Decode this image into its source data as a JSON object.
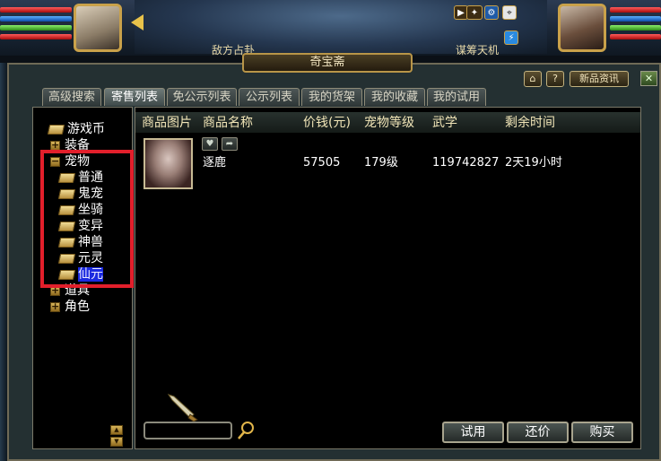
{
  "hud": {
    "left_label": "敌方占卦",
    "right_label": "谋筹天机",
    "window_title": "奇宝斋"
  },
  "toolbar": {
    "home_icon": "home-icon",
    "help_label": "?",
    "news_label": "新品资讯",
    "close_label": "✕"
  },
  "tabs": [
    {
      "label": "高级搜索"
    },
    {
      "label": "寄售列表"
    },
    {
      "label": "免公示列表"
    },
    {
      "label": "公示列表"
    },
    {
      "label": "我的货架"
    },
    {
      "label": "我的收藏"
    },
    {
      "label": "我的试用"
    }
  ],
  "tree": {
    "items": [
      {
        "label": "游戏币"
      },
      {
        "label": "装备"
      },
      {
        "label": "宠物"
      },
      {
        "label": "普通"
      },
      {
        "label": "鬼宠"
      },
      {
        "label": "坐骑"
      },
      {
        "label": "变异"
      },
      {
        "label": "神兽"
      },
      {
        "label": "元灵"
      },
      {
        "label": "仙元"
      },
      {
        "label": "道具"
      },
      {
        "label": "角色"
      }
    ]
  },
  "table": {
    "columns": [
      "商品图片",
      "商品名称",
      "价钱(元)",
      "宠物等级",
      "武学",
      "剩余时间"
    ],
    "rows": [
      {
        "name": "逐鹿",
        "price": "57505",
        "level": "179级",
        "wuxue": "119742827",
        "time_left": "2天19小时"
      }
    ]
  },
  "search": {
    "value": ""
  },
  "actions": {
    "trial_label": "试用",
    "bargain_label": "还价",
    "buy_label": "购买"
  },
  "colors": {
    "highlight": "#e21f2b",
    "selected": "#1b2ae0"
  }
}
